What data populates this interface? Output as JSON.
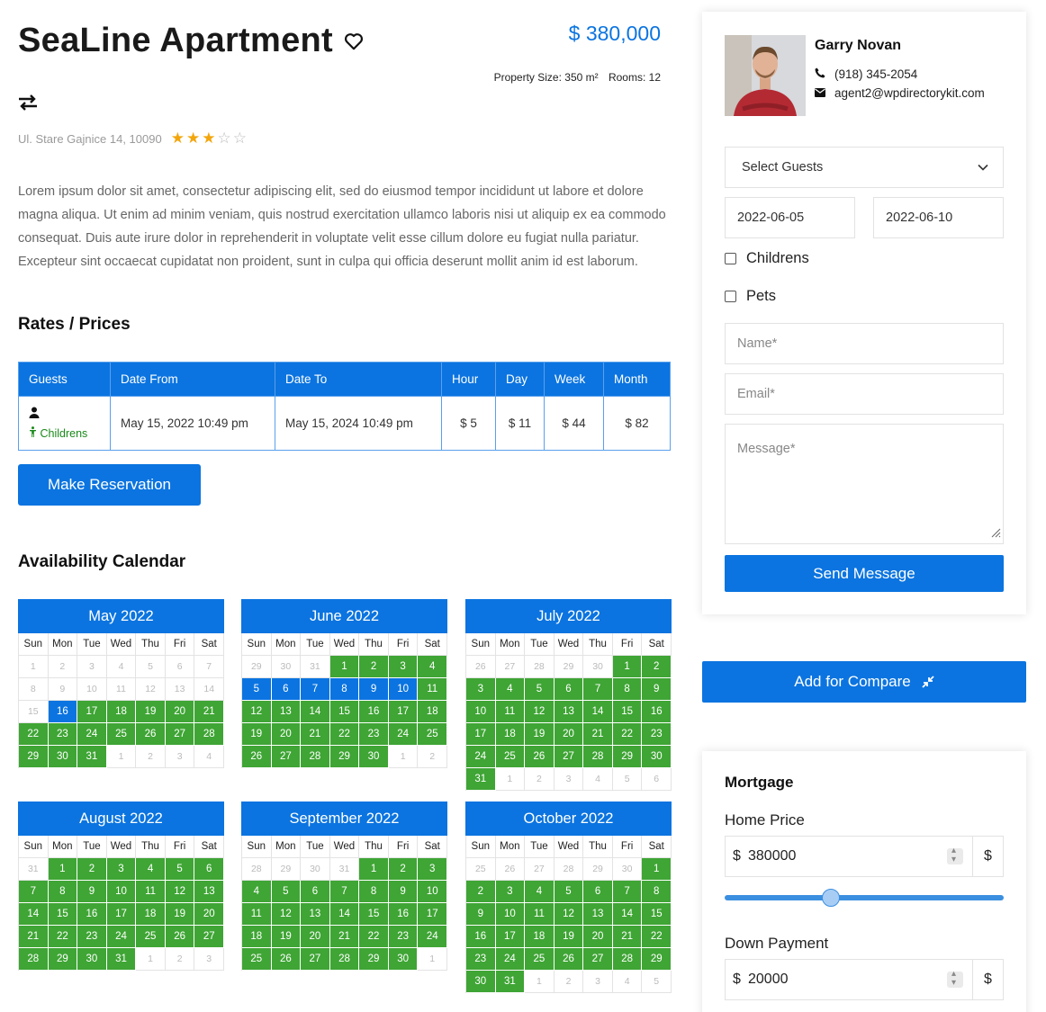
{
  "property": {
    "title": "SeaLine Apartment",
    "price": "$ 380,000",
    "size": "Property Size: 350 m²",
    "rooms": "Rooms: 12",
    "address": "Ul. Stare Gajnice 14, 10090",
    "rating": 3,
    "rating_max": 5,
    "description": "Lorem ipsum dolor sit amet, consectetur adipiscing elit, sed do eiusmod tempor incididunt ut labore et dolore magna aliqua. Ut enim ad minim veniam, quis nostrud exercitation ullamco laboris nisi ut aliquip ex ea commodo consequat. Duis aute irure dolor in reprehenderit in voluptate velit esse cillum dolore eu fugiat nulla pariatur. Excepteur sint occaecat cupidatat non proident, sunt in culpa qui officia deserunt mollit anim id est laborum."
  },
  "rates": {
    "heading": "Rates / Prices",
    "columns": [
      "Guests",
      "Date From",
      "Date To",
      "Hour",
      "Day",
      "Week",
      "Month"
    ],
    "row": {
      "guests_note": "Childrens",
      "date_from": "May 15, 2022 10:49 pm",
      "date_to": "May 15, 2024 10:49 pm",
      "hour": "$ 5",
      "day": "$ 11",
      "week": "$ 44",
      "month": "$ 82"
    },
    "reserve_label": "Make Reservation"
  },
  "calendar": {
    "heading": "Availability Calendar",
    "day_names": [
      "Sun",
      "Mon",
      "Tue",
      "Wed",
      "Thu",
      "Fri",
      "Sat"
    ],
    "months": [
      {
        "title": "May 2022",
        "lead": [],
        "days": 31,
        "start": 0,
        "booked": [
          16
        ],
        "available_from": 17,
        "trail_start": 1
      },
      {
        "title": "June 2022",
        "lead": [
          29,
          30,
          31
        ],
        "days": 30,
        "start": 3,
        "booked": [
          5,
          6,
          7,
          8,
          9,
          10
        ],
        "available_from": 1,
        "trail_start": 1
      },
      {
        "title": "July 2022",
        "lead": [
          26,
          27,
          28,
          29,
          30
        ],
        "days": 31,
        "start": 5,
        "booked": [],
        "available_from": 1,
        "trail_start": 1
      },
      {
        "title": "August 2022",
        "lead": [
          31
        ],
        "days": 31,
        "start": 1,
        "booked": [],
        "available_from": 1,
        "trail_start": 1
      },
      {
        "title": "September 2022",
        "lead": [
          28,
          29,
          30,
          31
        ],
        "days": 30,
        "start": 4,
        "booked": [],
        "available_from": 1,
        "trail_start": 1
      },
      {
        "title": "October 2022",
        "lead": [
          25,
          26,
          27,
          28,
          29,
          30
        ],
        "days": 31,
        "start": 6,
        "booked": [],
        "available_from": 1,
        "trail_start": 1
      }
    ]
  },
  "agent": {
    "name": "Garry Novan",
    "phone": "(918) 345-2054",
    "email": "agent2@wpdirectorykit.com"
  },
  "booking_form": {
    "guests_select": "Select Guests",
    "date_from": "2022-06-05",
    "date_to": "2022-06-10",
    "childrens_label": "Childrens",
    "pets_label": "Pets",
    "name_placeholder": "Name*",
    "email_placeholder": "Email*",
    "message_placeholder": "Message*",
    "send_label": "Send Message"
  },
  "compare_label": "Add for Compare",
  "mortgage": {
    "title": "Mortgage",
    "home_price_label": "Home Price",
    "home_price": "380000",
    "home_price_slider_fraction": 0.38,
    "down_payment_label": "Down Payment",
    "down_payment": "20000",
    "currency": "$"
  },
  "colors": {
    "accent": "#0b74e0",
    "available": "#3fa535",
    "star": "#f2a60c"
  }
}
